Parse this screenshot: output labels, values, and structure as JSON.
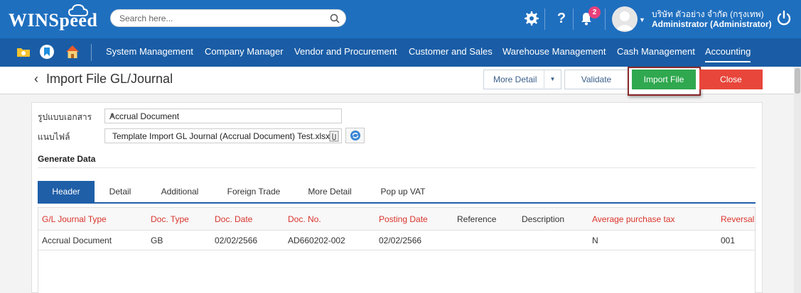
{
  "app": {
    "logo_text": "WINSpeed"
  },
  "search": {
    "placeholder": "Search here..."
  },
  "notifications": {
    "count": "2"
  },
  "user": {
    "company": "บริษัท ตัวอย่าง จำกัด (กรุงเทพ)",
    "name": "Administrator (Administrator)"
  },
  "menu": {
    "items": [
      {
        "label": "System Management"
      },
      {
        "label": "Company Manager"
      },
      {
        "label": "Vendor and Procurement"
      },
      {
        "label": "Customer and Sales"
      },
      {
        "label": "Warehouse Management"
      },
      {
        "label": "Cash Management"
      },
      {
        "label": "Accounting"
      }
    ],
    "active": "Accounting"
  },
  "page": {
    "title": "Import File GL/Journal",
    "buttons": {
      "more_detail": "More Detail",
      "validate": "Validate",
      "import_file": "Import File",
      "close": "Close"
    }
  },
  "form": {
    "doc_format_label": "รูปแบบเอกสาร",
    "doc_format_value": "Accrual Document",
    "attach_label": "แนบไฟล์",
    "attach_value": "Template Import GL Journal (Accrual Document) Test.xlsx"
  },
  "section": {
    "title": "Generate Data"
  },
  "tabs": [
    {
      "label": "Header"
    },
    {
      "label": "Detail"
    },
    {
      "label": "Additional"
    },
    {
      "label": "Foreign Trade"
    },
    {
      "label": "More Detail"
    },
    {
      "label": "Pop up VAT"
    }
  ],
  "active_tab": "Header",
  "table": {
    "columns": [
      {
        "label": "G/L Journal Type",
        "required": true
      },
      {
        "label": "Doc. Type",
        "required": true
      },
      {
        "label": "Doc. Date",
        "required": true
      },
      {
        "label": "Doc. No.",
        "required": true
      },
      {
        "label": "Posting Date",
        "required": true
      },
      {
        "label": "Reference",
        "required": false
      },
      {
        "label": "Description",
        "required": false
      },
      {
        "label": "Average purchase tax",
        "required": true
      },
      {
        "label": "Reversal F",
        "required": true
      }
    ],
    "rows": [
      [
        "Accrual Document",
        "GB",
        "02/02/2566",
        "AD660202-002",
        "02/02/2566",
        "",
        "",
        "N",
        "001"
      ]
    ]
  },
  "colors": {
    "header_bg": "#1f6fbf",
    "menu_bg": "#1a5da6",
    "import_button": "#2fa84f",
    "close_button": "#e8463b",
    "required_column": "#d9342b",
    "badge": "#e8407a"
  },
  "icons": [
    "cloud-icon",
    "search-icon",
    "gear-icon",
    "help-icon",
    "bell-icon",
    "avatar",
    "power-icon",
    "folder-icon",
    "bookmark-icon",
    "home-icon",
    "paperclip-icon",
    "refresh-icon"
  ]
}
